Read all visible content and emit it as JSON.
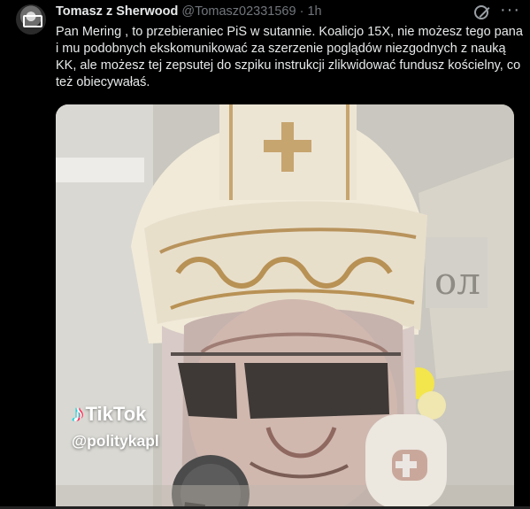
{
  "tweet": {
    "author_name": "Tomasz z Sherwood",
    "handle": "@Tomasz02331569",
    "separator": "·",
    "time": "1h",
    "text": "Pan Mering , to przebieraniec PiS w sutannie. Koalicjo 15X, nie możesz tego pana i mu podobnych ekskomunikować za szerzenie poglądów niezgodnych z nauką KK, ale możesz tej zepsutej do szpiku instrukcji zlikwidować fundusz kościelny,  co też obiecywałaś.",
    "more_label": "···"
  },
  "media": {
    "watermark_brand": "TikTok",
    "watermark_user": "@politykapl"
  },
  "icons": {
    "grok": "grok-icon",
    "more": "more-icon",
    "tiktok": "tiktok-icon"
  },
  "colors": {
    "background": "#000000",
    "text": "#e7e9ea",
    "secondary": "#71767b"
  }
}
